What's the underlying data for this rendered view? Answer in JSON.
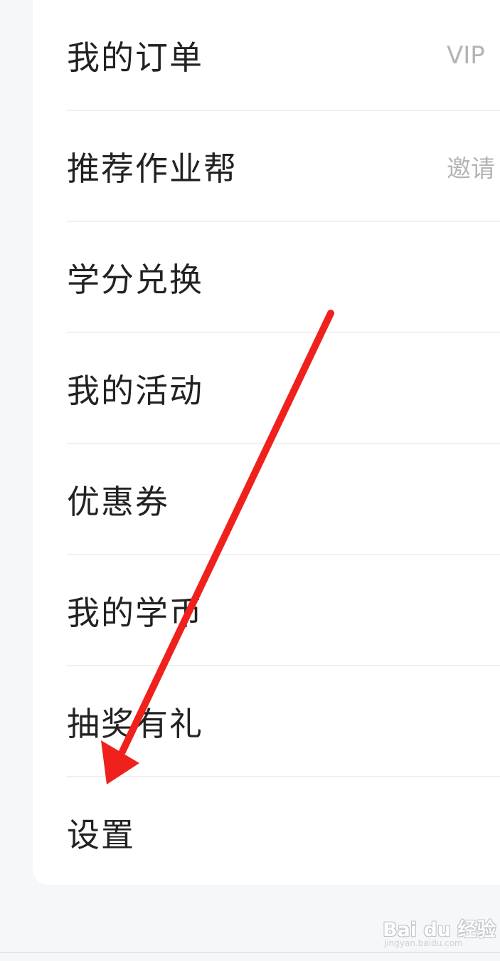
{
  "menu": {
    "items": [
      {
        "label": "我的订单",
        "trailing": "VIP"
      },
      {
        "label": "推荐作业帮",
        "trailing": "邀请"
      },
      {
        "label": "学分兑换",
        "trailing": ""
      },
      {
        "label": "我的活动",
        "trailing": ""
      },
      {
        "label": "优惠券",
        "trailing": ""
      },
      {
        "label": "我的学币",
        "trailing": ""
      },
      {
        "label": "抽奖有礼",
        "trailing": ""
      },
      {
        "label": "设置",
        "trailing": ""
      }
    ]
  },
  "annotation": {
    "arrow_color": "#f0211d"
  },
  "watermark": {
    "main": "Bai du 经验",
    "sub": "jingyan.baidu.com"
  },
  "colors": {
    "background": "#f6f7f9",
    "card": "#ffffff",
    "label": "#222222",
    "hint": "#b4b4b4"
  }
}
